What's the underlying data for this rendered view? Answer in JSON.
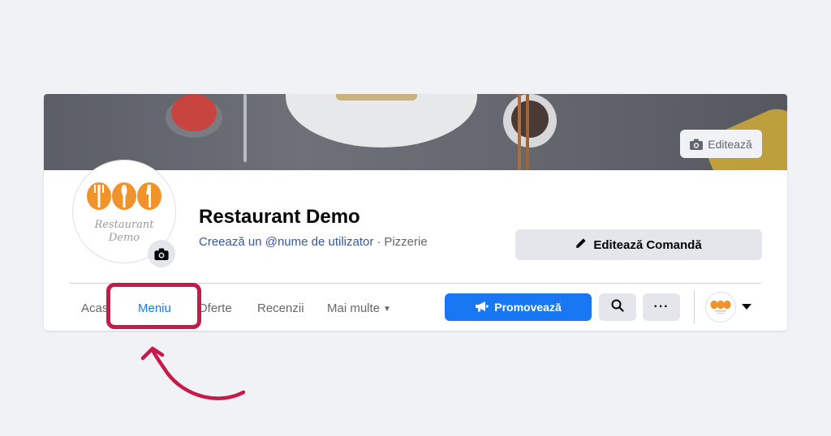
{
  "cover": {
    "edit_label": "Editează",
    "camera_icon": "camera-icon"
  },
  "profile": {
    "logo_line1": "Restaurant",
    "logo_line2": "Demo",
    "camera_icon": "camera-icon"
  },
  "page": {
    "title": "Restaurant Demo",
    "username_link": "Creează un @nume de utilizator",
    "separator": "·",
    "category": "Pizzerie"
  },
  "actions": {
    "edit_order_label": "Editează Comandă",
    "edit_order_icon": "pencil-icon",
    "promote_label": "Promovează",
    "promote_icon": "megaphone-icon",
    "search_icon": "search-icon",
    "more_label": "···"
  },
  "tabs": [
    {
      "label": "Acasă",
      "active": false
    },
    {
      "label": "Meniu",
      "active": true
    },
    {
      "label": "Oferte",
      "active": false
    },
    {
      "label": "Recenzii",
      "active": false
    },
    {
      "label": "Mai multe",
      "active": false,
      "has_dropdown": true
    }
  ],
  "annotation": {
    "highlight_color": "#c8194b",
    "highlighted_tab": "Meniu"
  },
  "colors": {
    "accent": "#1877f2",
    "link": "#385898",
    "logo_orange": "#f0932b",
    "background": "#f0f2f5"
  }
}
